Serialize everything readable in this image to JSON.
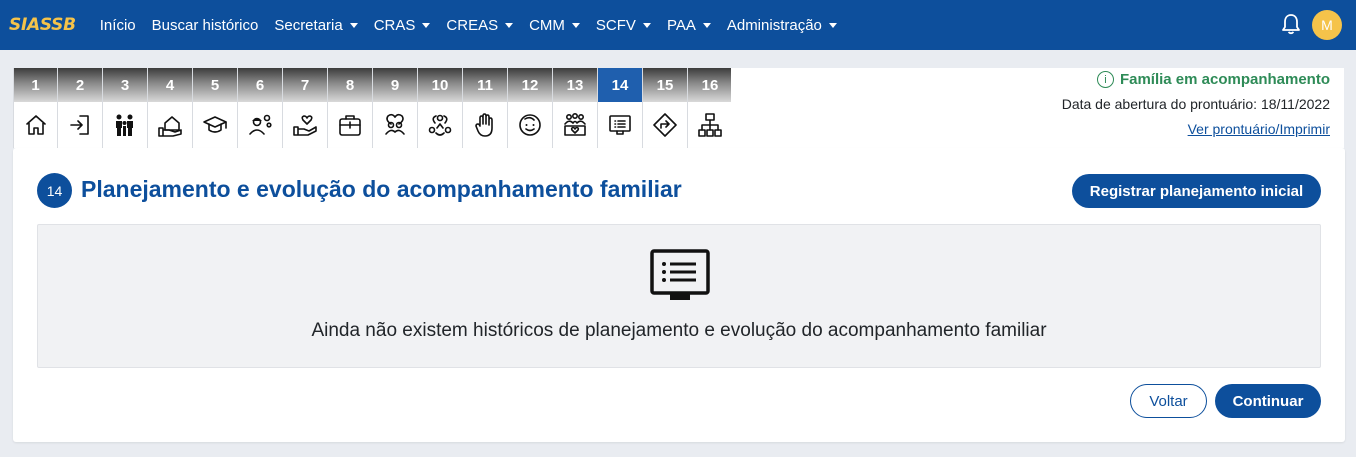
{
  "app": {
    "brand": "SIASSB",
    "user_initial": "M"
  },
  "nav": {
    "items": [
      {
        "label": "Início",
        "dropdown": false
      },
      {
        "label": "Buscar histórico",
        "dropdown": false
      },
      {
        "label": "Secretaria",
        "dropdown": true
      },
      {
        "label": "CRAS",
        "dropdown": true
      },
      {
        "label": "CREAS",
        "dropdown": true
      },
      {
        "label": "CMM",
        "dropdown": true
      },
      {
        "label": "SCFV",
        "dropdown": true
      },
      {
        "label": "PAA",
        "dropdown": true
      },
      {
        "label": "Administração",
        "dropdown": true
      }
    ]
  },
  "steps": [
    {
      "num": "1",
      "icon": "home-icon"
    },
    {
      "num": "2",
      "icon": "login-icon"
    },
    {
      "num": "3",
      "icon": "family-icon"
    },
    {
      "num": "4",
      "icon": "housing-hand-icon"
    },
    {
      "num": "5",
      "icon": "graduation-cap-icon"
    },
    {
      "num": "6",
      "icon": "worker-gear-icon"
    },
    {
      "num": "7",
      "icon": "hand-heart-icon"
    },
    {
      "num": "8",
      "icon": "first-aid-kit-icon"
    },
    {
      "num": "9",
      "icon": "people-heart-icon"
    },
    {
      "num": "10",
      "icon": "network-people-icon"
    },
    {
      "num": "11",
      "icon": "raised-hand-icon"
    },
    {
      "num": "12",
      "icon": "child-face-icon"
    },
    {
      "num": "13",
      "icon": "community-icon"
    },
    {
      "num": "14",
      "icon": "display-list-icon"
    },
    {
      "num": "15",
      "icon": "direction-sign-icon"
    },
    {
      "num": "16",
      "icon": "sitemap-icon"
    }
  ],
  "active_step": "14",
  "info": {
    "status": "Família em acompanhamento",
    "status_color": "#2e8b57",
    "opened": "Data de abertura do prontuário: 18/11/2022",
    "print_link": "Ver prontuário/Imprimir"
  },
  "section": {
    "number": "14",
    "title": "Planejamento e evolução do acompanhamento familiar",
    "register_button": "Registrar planejamento inicial",
    "empty_message": "Ainda não existem históricos de planejamento e evolução do acompanhamento familiar",
    "back_button": "Voltar",
    "continue_button": "Continuar"
  },
  "colors": {
    "primary": "#0d4f9c",
    "brand_text": "#f5c34a",
    "active_tab": "#1f5fae"
  }
}
